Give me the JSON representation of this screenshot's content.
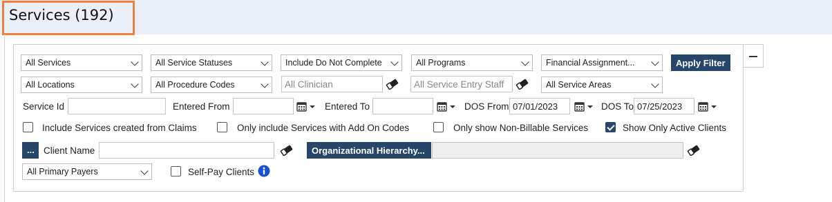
{
  "header": {
    "title": "Services (192)"
  },
  "filters": {
    "row1": {
      "services": "All Services",
      "service_statuses": "All Service Statuses",
      "do_not_complete": "Include Do Not Complete",
      "programs": "All Programs",
      "financial_assignment": "Financial Assignment...",
      "apply_filter": "Apply Filter"
    },
    "row2": {
      "locations": "All Locations",
      "procedure_codes": "All Procedure Codes",
      "clinician_placeholder": "All Clinician",
      "entry_staff_placeholder": "All Service Entry Staff",
      "service_areas": "All Service Areas"
    },
    "row3": {
      "service_id_label": "Service Id",
      "service_id_value": "",
      "entered_from_label": "Entered From",
      "entered_from_value": "",
      "entered_to_label": "Entered To",
      "entered_to_value": "",
      "dos_from_label": "DOS From",
      "dos_from_value": "07/01/2023",
      "dos_to_label": "DOS To",
      "dos_to_value": "07/25/2023"
    },
    "row4": {
      "include_claims": {
        "label": "Include Services created from Claims",
        "checked": false
      },
      "add_on_codes": {
        "label": "Only include Services with Add On Codes",
        "checked": false
      },
      "non_billable": {
        "label": "Only show Non-Billable Services",
        "checked": false
      },
      "active_clients": {
        "label": "Show Only Active Clients",
        "checked": true
      }
    },
    "row5": {
      "ellipsis_button": "...",
      "client_name_label": "Client Name",
      "client_name_value": "",
      "org_hierarchy_button": "Organizational Hierarchy...",
      "org_hierarchy_value": ""
    },
    "row6": {
      "primary_payers": "All Primary Payers",
      "self_pay": {
        "label": "Self-Pay Clients",
        "checked": false
      }
    }
  },
  "colors": {
    "accent": "#26476a",
    "header_band": "#e9f0f9",
    "title_border": "#f07f3c",
    "info_icon": "#1a4fd6"
  }
}
